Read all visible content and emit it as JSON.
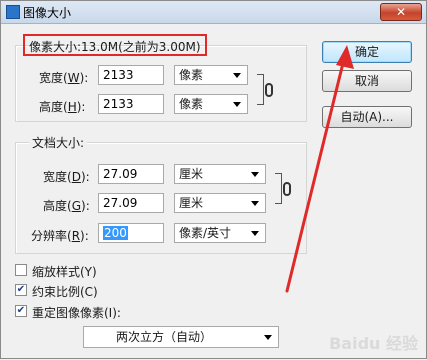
{
  "window": {
    "title": "图像大小",
    "close_label": "✕"
  },
  "pixel_size": {
    "label": "像素大小:13.0M(之前为3.00M)",
    "width_label": "宽度",
    "width_key": "W",
    "width_value": "2133",
    "width_unit": "像素",
    "height_label": "高度",
    "height_key": "H",
    "height_value": "2133",
    "height_unit": "像素"
  },
  "document_size": {
    "legend": "文档大小:",
    "width_label": "宽度",
    "width_key": "D",
    "width_value": "27.09",
    "width_unit": "厘米",
    "height_label": "高度",
    "height_key": "G",
    "height_value": "27.09",
    "height_unit": "厘米",
    "resolution_label": "分辨率",
    "resolution_key": "R",
    "resolution_value": "200",
    "resolution_unit": "像素/英寸"
  },
  "buttons": {
    "ok": "确定",
    "cancel": "取消",
    "auto": "自动(A)..."
  },
  "options": {
    "scale_styles": "缩放样式(Y)",
    "scale_styles_checked": false,
    "constrain": "约束比例(C)",
    "constrain_checked": true,
    "resample": "重定图像像素(I):",
    "resample_checked": true,
    "resample_method": "两次立方（自动）"
  },
  "watermark": "Baidu 经验",
  "colors": {
    "highlight": "#e02a2a",
    "selection": "#3399ff"
  }
}
